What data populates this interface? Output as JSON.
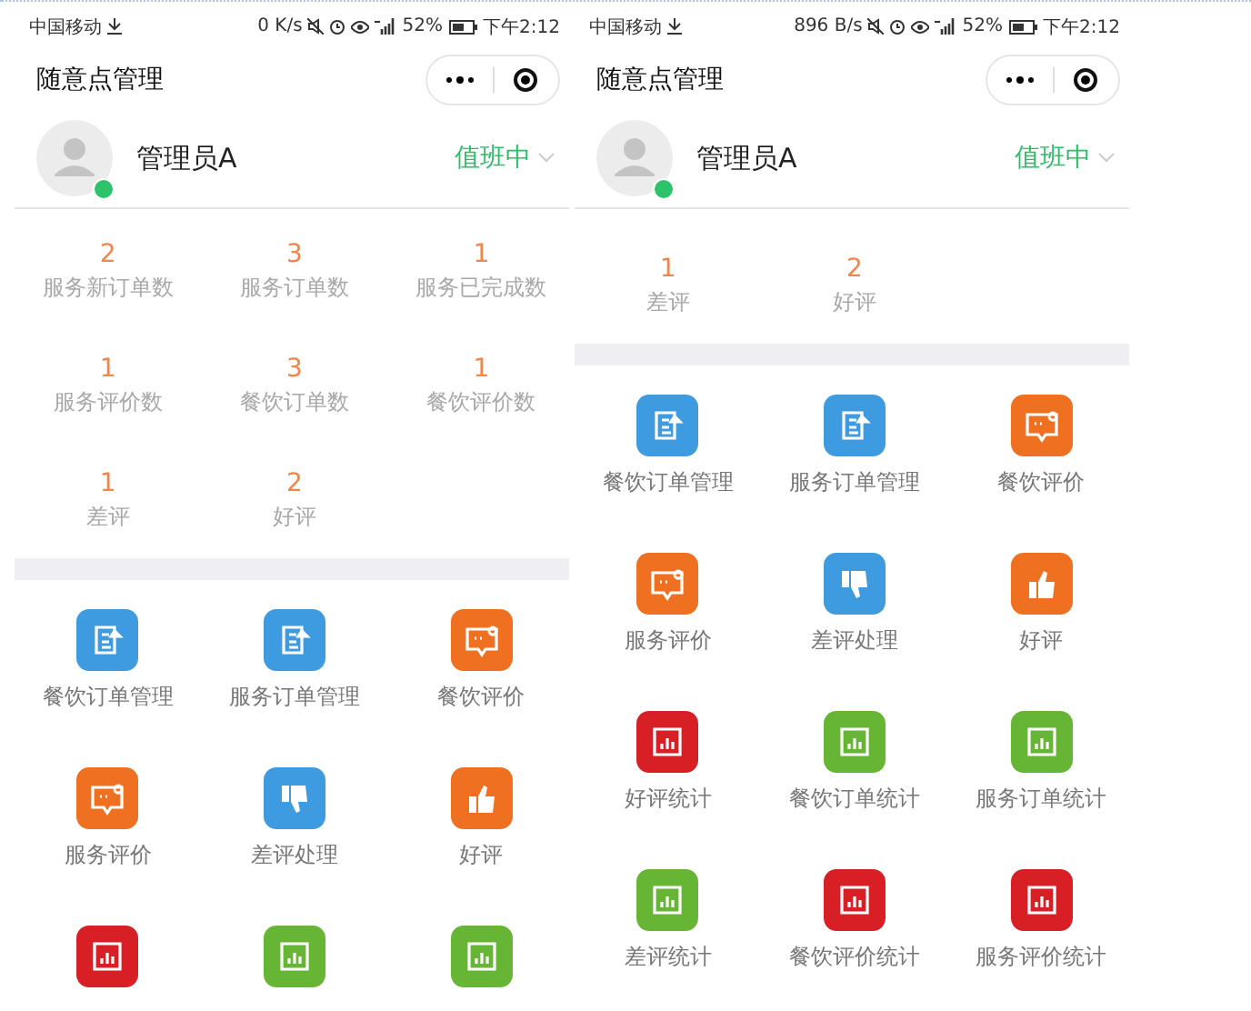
{
  "phones": [
    {
      "status_bar": {
        "carrier": "中国移动",
        "speed": "0 K/s",
        "battery": "52%",
        "time": "下午2:12"
      },
      "title": "随意点管理",
      "user": {
        "name": "管理员A",
        "online": true,
        "duty_status": "值班中"
      },
      "stats_scrolled": false,
      "stats": [
        {
          "value": "2",
          "label": "服务新订单数"
        },
        {
          "value": "3",
          "label": "服务订单数"
        },
        {
          "value": "1",
          "label": "服务已完成数"
        },
        {
          "value": "1",
          "label": "服务评价数"
        },
        {
          "value": "3",
          "label": "餐饮订单数"
        },
        {
          "value": "1",
          "label": "餐饮评价数"
        },
        {
          "value": "1",
          "label": "差评"
        },
        {
          "value": "2",
          "label": "好评"
        }
      ],
      "menu": [
        {
          "label": "餐饮订单管理",
          "kind": "document",
          "color": "#3f9be0"
        },
        {
          "label": "服务订单管理",
          "kind": "document",
          "color": "#3f9be0"
        },
        {
          "label": "餐饮评价",
          "kind": "chat",
          "color": "#ee7020"
        },
        {
          "label": "服务评价",
          "kind": "chat",
          "color": "#ee7020"
        },
        {
          "label": "差评处理",
          "kind": "thumbs-down",
          "color": "#3f9be0"
        },
        {
          "label": "好评",
          "kind": "thumbs-up",
          "color": "#ee7020"
        },
        {
          "kind": "chart",
          "color": "#d91f26"
        },
        {
          "kind": "chart",
          "color": "#66b535"
        },
        {
          "kind": "chart",
          "color": "#66b535"
        }
      ]
    },
    {
      "status_bar": {
        "carrier": "中国移动",
        "speed": "896 B/s",
        "battery": "52%",
        "time": "下午2:12"
      },
      "title": "随意点管理",
      "user": {
        "name": "管理员A",
        "online": true,
        "duty_status": "值班中"
      },
      "stats_scrolled": true,
      "stats": [
        {
          "value": "1",
          "label": "差评"
        },
        {
          "value": "2",
          "label": "好评"
        }
      ],
      "menu": [
        {
          "label": "餐饮订单管理",
          "kind": "document",
          "color": "#3f9be0"
        },
        {
          "label": "服务订单管理",
          "kind": "document",
          "color": "#3f9be0"
        },
        {
          "label": "餐饮评价",
          "kind": "chat",
          "color": "#ee7020"
        },
        {
          "label": "服务评价",
          "kind": "chat",
          "color": "#ee7020"
        },
        {
          "label": "差评处理",
          "kind": "thumbs-down",
          "color": "#3f9be0"
        },
        {
          "label": "好评",
          "kind": "thumbs-up",
          "color": "#ee7020"
        },
        {
          "label": "好评统计",
          "kind": "chart",
          "color": "#d91f26"
        },
        {
          "label": "餐饮订单统计",
          "kind": "chart",
          "color": "#66b535"
        },
        {
          "label": "服务订单统计",
          "kind": "chart",
          "color": "#66b535"
        },
        {
          "label": "差评统计",
          "kind": "chart",
          "color": "#66b535"
        },
        {
          "label": "餐饮评价统计",
          "kind": "chart",
          "color": "#d91f26"
        },
        {
          "label": "服务评价统计",
          "kind": "chart",
          "color": "#d91f26"
        }
      ]
    }
  ]
}
